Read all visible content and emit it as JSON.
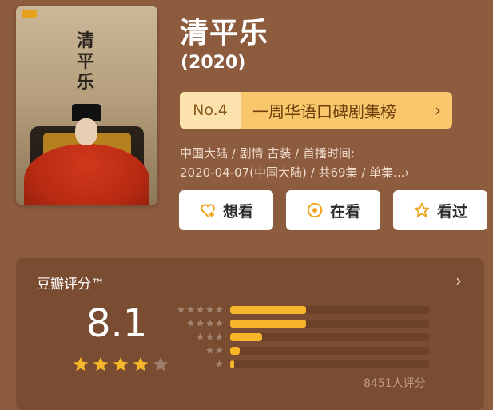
{
  "poster": {
    "title_chars": [
      "清",
      "平",
      "乐"
    ]
  },
  "show": {
    "title": "清平乐",
    "year": "(2020)"
  },
  "rank": {
    "no": "No.4",
    "label": "一周华语口碑剧集榜",
    "chevron": "›"
  },
  "meta": {
    "line1": "中国大陆 / 剧情 古装 / 首播时间:",
    "line2": "2020-04-07(中国大陆) / 共69集 / 单集...›"
  },
  "actions": [
    {
      "label": "想看",
      "icon": "heart-plus-icon",
      "color": "#f0a21a"
    },
    {
      "label": "在看",
      "icon": "target-circle-icon",
      "color": "#f0a21a"
    },
    {
      "label": "看过",
      "icon": "star-outline-icon",
      "color": "#f0a21a"
    }
  ],
  "rating": {
    "heading": "豆瓣评分™",
    "chevron": "›",
    "score": "8.1",
    "stars": 4.0,
    "count_label": "8451人评分",
    "distribution": [
      {
        "stars": 5,
        "fraction": 0.38
      },
      {
        "stars": 4,
        "fraction": 0.38
      },
      {
        "stars": 3,
        "fraction": 0.16
      },
      {
        "stars": 2,
        "fraction": 0.05
      },
      {
        "stars": 1,
        "fraction": 0.02
      }
    ]
  },
  "colors": {
    "background": "#8d5c3f",
    "card": "#7a4c31",
    "accent": "#f7b52a",
    "rank_bg": "#f9c76b"
  }
}
